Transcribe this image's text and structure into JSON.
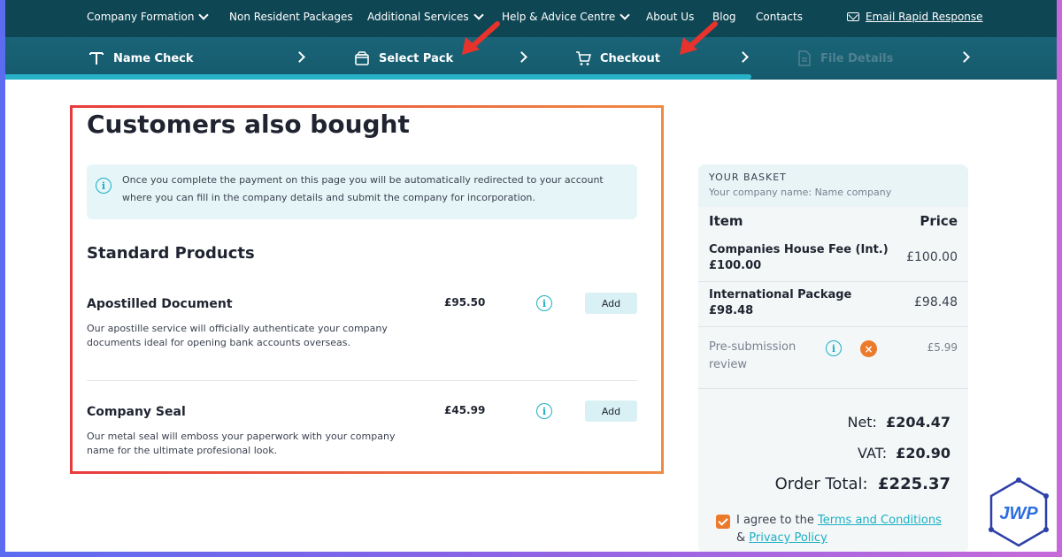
{
  "nav": {
    "items": [
      {
        "label": "Company Formation",
        "dropdown": true
      },
      {
        "label": "Non Resident Packages",
        "dropdown": false
      },
      {
        "label": "Additional Services",
        "dropdown": true
      },
      {
        "label": "Help & Advice Centre",
        "dropdown": true
      },
      {
        "label": "About Us",
        "dropdown": false
      },
      {
        "label": "Blog",
        "dropdown": false
      },
      {
        "label": "Contacts",
        "dropdown": false
      }
    ],
    "email_label": "Email Rapid Response"
  },
  "steps": [
    {
      "label": "Name Check",
      "icon": "text-t-icon",
      "state": "done"
    },
    {
      "label": "Select Pack",
      "icon": "box-icon",
      "state": "done"
    },
    {
      "label": "Checkout",
      "icon": "cart-icon",
      "state": "active"
    },
    {
      "label": "File Details",
      "icon": "document-icon",
      "state": "disabled"
    }
  ],
  "progress_fraction": 0.71,
  "main": {
    "title": "Customers also bought",
    "notice": "Once you complete the payment on this page you will be automatically redirected to your account where you can fill in the company details and submit the company for incorporation.",
    "section_title": "Standard Products",
    "products": [
      {
        "name": "Apostilled Document",
        "price": "£95.50",
        "description": "Our apostille service will officially authenticate your company documents ideal for opening bank accounts overseas.",
        "add_label": "Add"
      },
      {
        "name": "Company Seal",
        "price": "£45.99",
        "description": "Our metal seal will emboss your paperwork with your company name for the ultimate profesional look.",
        "add_label": "Add"
      }
    ]
  },
  "basket": {
    "title": "YOUR BASKET",
    "subtitle": "Your company name: Name company",
    "col_item": "Item",
    "col_price": "Price",
    "rows": [
      {
        "item": "Companies House Fee (Int.) £100.00",
        "price": "£100.00"
      },
      {
        "item": "International Package £98.48",
        "price": "£98.48"
      },
      {
        "item": "Pre-submission review",
        "price": "£5.99"
      }
    ],
    "net_label": "Net:",
    "net_value": "£204.47",
    "vat_label": "VAT:",
    "vat_value": "£20.90",
    "total_label": "Order Total:",
    "total_value": "£225.37",
    "agree_prefix": "I agree to the",
    "terms_label": "Terms and Conditions",
    "and_label": "&",
    "privacy_label": "Privacy Policy"
  },
  "colors": {
    "nav_bg": "#0f4654",
    "accent": "#1ab0c4",
    "orange": "#ec7a2b",
    "highlight_start": "#e83c3c",
    "highlight_end": "#ef8a45",
    "annotation_arrow": "#e8332d"
  },
  "logo_text": "JWP"
}
